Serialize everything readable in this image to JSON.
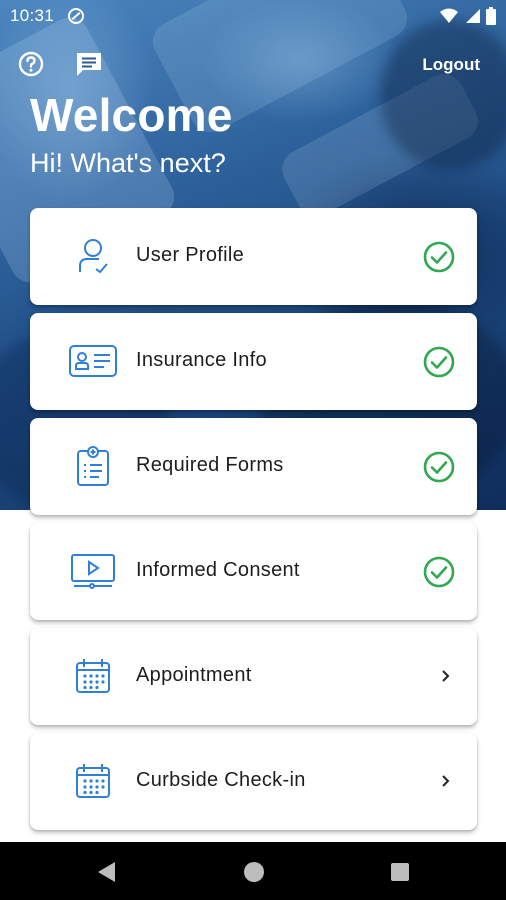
{
  "status_bar": {
    "time": "10:31"
  },
  "header": {
    "logout_label": "Logout",
    "title": "Welcome",
    "subtitle": "Hi! What's next?"
  },
  "menu": {
    "items": [
      {
        "label": "User Profile",
        "icon": "user-profile-icon",
        "status": "complete"
      },
      {
        "label": "Insurance Info",
        "icon": "id-card-icon",
        "status": "complete"
      },
      {
        "label": "Required Forms",
        "icon": "clipboard-icon",
        "status": "complete"
      },
      {
        "label": "Informed Consent",
        "icon": "video-monitor-icon",
        "status": "complete"
      },
      {
        "label": "Appointment",
        "icon": "calendar-icon",
        "status": "pending"
      },
      {
        "label": "Curbside Check-in",
        "icon": "calendar-icon",
        "status": "pending"
      }
    ]
  },
  "colors": {
    "accent_blue": "#2f80d6",
    "check_green": "#2fa84f",
    "hero_dark": "#0f2d5a"
  }
}
